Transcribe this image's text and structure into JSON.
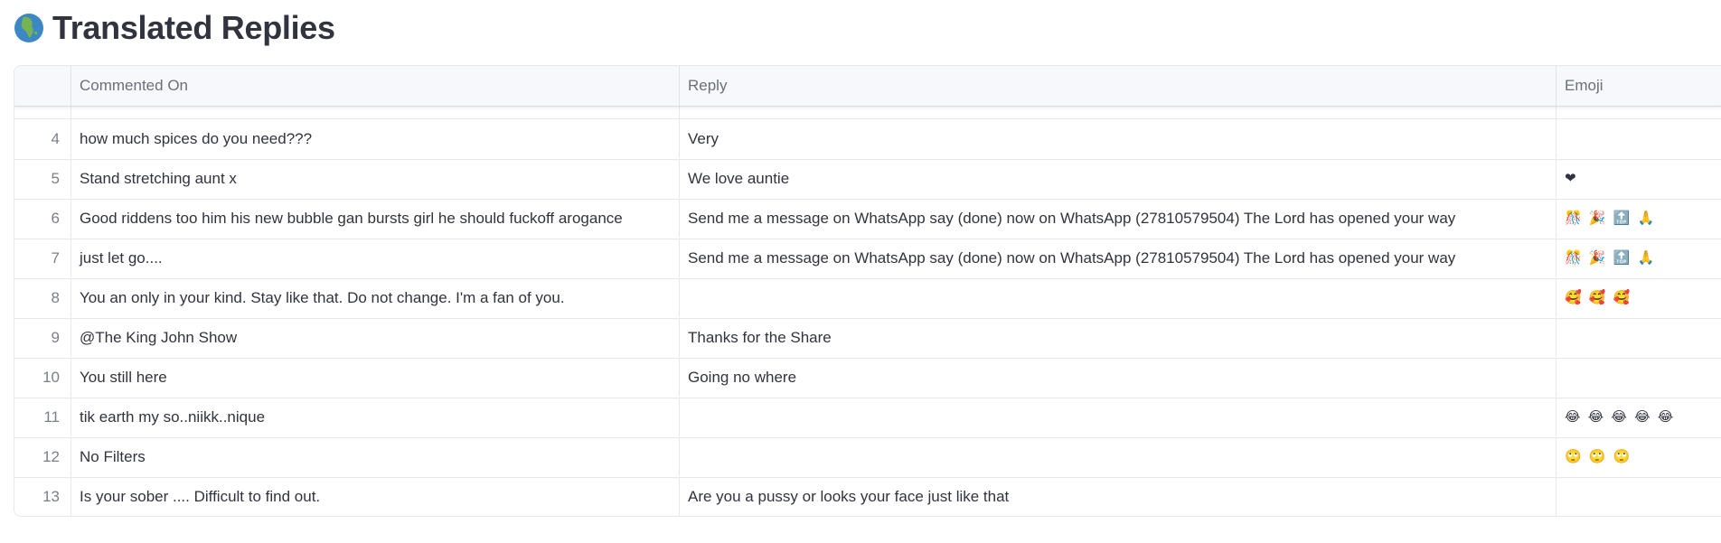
{
  "page": {
    "title_icon": "globe-africa-icon",
    "title": "Translated Replies"
  },
  "table": {
    "columns": [
      "",
      "Commented On",
      "Reply",
      "Emoji"
    ],
    "rows": [
      {
        "index": "4",
        "commented_on": "how much spices do you need???",
        "reply": "Very",
        "emoji": ""
      },
      {
        "index": "5",
        "commented_on": "Stand stretching aunt x",
        "reply": "We love auntie",
        "emoji": "❤"
      },
      {
        "index": "6",
        "commented_on": "Good riddens too him his new bubble gan bursts girl he should fuckoff arogance",
        "reply": "Send me a message on WhatsApp say (done) now on WhatsApp (27810579504) The Lord has opened your way",
        "emoji": "🎊 🎉 🔝 🙏"
      },
      {
        "index": "7",
        "commented_on": "just let go....",
        "reply": "Send me a message on WhatsApp say (done) now on WhatsApp (27810579504) The Lord has opened your way",
        "emoji": "🎊 🎉 🔝 🙏"
      },
      {
        "index": "8",
        "commented_on": "You an only in your kind. Stay like that. Do not change. I'm a fan of you.",
        "reply": "",
        "emoji": "🥰 🥰 🥰"
      },
      {
        "index": "9",
        "commented_on": "@The King John Show",
        "reply": "Thanks for the Share",
        "emoji": ""
      },
      {
        "index": "10",
        "commented_on": "You still here",
        "reply": "Going no where",
        "emoji": ""
      },
      {
        "index": "11",
        "commented_on": "tik earth my so..niikk..nique",
        "reply": "",
        "emoji": "😂 😂 😂 😂 😂"
      },
      {
        "index": "12",
        "commented_on": "No Filters",
        "reply": "",
        "emoji": "🙄 🙄 🙄"
      },
      {
        "index": "13",
        "commented_on": "Is your sober .... Difficult to find out.",
        "reply": "Are you a pussy or looks your face just like that",
        "emoji": ""
      }
    ]
  }
}
